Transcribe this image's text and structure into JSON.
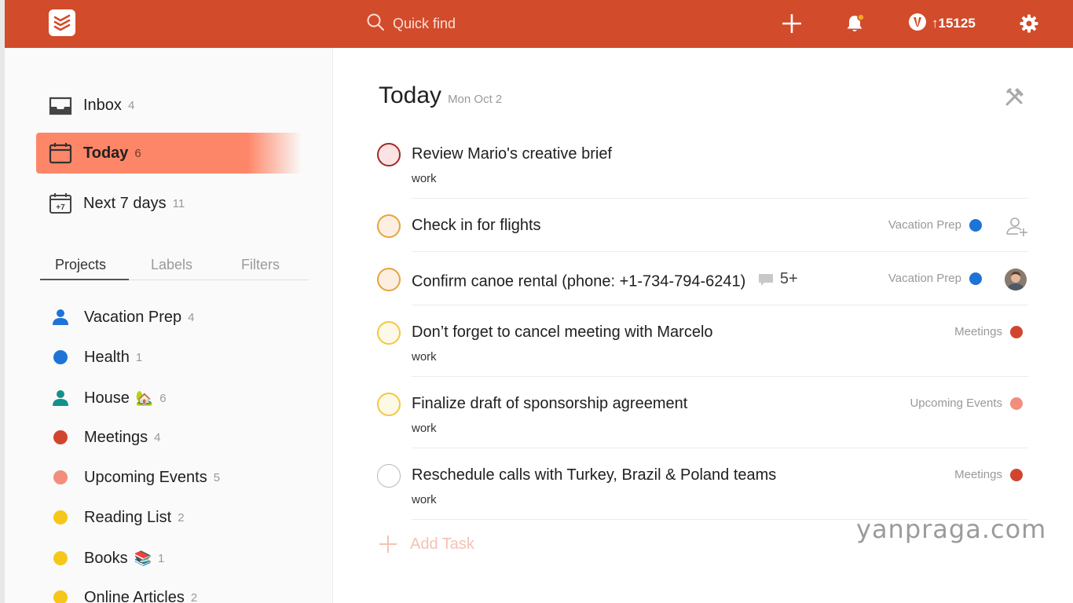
{
  "topbar": {
    "search_placeholder": "Quick find",
    "karma": "↑15125",
    "icons": [
      "todoist-logo-icon",
      "search-icon",
      "plus-icon",
      "bell-icon",
      "karma-icon",
      "gear-icon"
    ],
    "color": "#d24b2b"
  },
  "sidebar": {
    "nav": [
      {
        "label": "Inbox",
        "count": "4",
        "icon": "inbox-icon"
      },
      {
        "label": "Today",
        "count": "6",
        "icon": "calendar-icon"
      },
      {
        "label": "Next 7 days",
        "count": "11",
        "icon": "calendar-plus7-icon"
      }
    ],
    "plus7": "+7",
    "tabs": [
      "Projects",
      "Labels",
      "Filters"
    ],
    "projects": [
      {
        "label": "Vacation Prep",
        "count": "4",
        "color": "#246fe0",
        "icon": "person-icon"
      },
      {
        "label": "Health",
        "count": "1",
        "color": "#1e73d6",
        "icon": "dot"
      },
      {
        "label": "House",
        "count": "6",
        "color": "#14aaa0",
        "icon": "person-icon",
        "emoji": "🏡"
      },
      {
        "label": "Meetings",
        "count": "4",
        "color": "#d1452f",
        "icon": "dot"
      },
      {
        "label": "Upcoming Events",
        "count": "5",
        "color": "#f28f7c",
        "icon": "dot"
      },
      {
        "label": "Reading List",
        "count": "2",
        "color": "#f5c71a",
        "icon": "dot"
      },
      {
        "label": "Books",
        "count": "1",
        "color": "#f5c71a",
        "icon": "dot",
        "emoji": "📚"
      },
      {
        "label": "Online Articles",
        "count": "2",
        "color": "#f5c71a",
        "icon": "dot"
      }
    ]
  },
  "main": {
    "title": "Today",
    "date": "Mon Oct 2",
    "tasks": [
      {
        "content": "Review Mario's creative brief",
        "label": "work",
        "project": "",
        "priority_color": "#c0392b",
        "fill": "#fbe3e3"
      },
      {
        "content": "Check in for flights",
        "label": "",
        "project": "Vacation Prep",
        "project_color": "#1e73d6",
        "priority_color": "#e8a33d",
        "fill": "#fcefe1",
        "action": "assign-icon"
      },
      {
        "content": "Confirm canoe rental (phone: +1-734-794-6241)",
        "comment_count": "5+",
        "label": "",
        "project": "Vacation Prep",
        "project_color": "#1e73d6",
        "priority_color": "#e8a33d",
        "fill": "#fcefe1",
        "action": "avatar"
      },
      {
        "content": "Don’t forget to cancel meeting with Marcelo",
        "label": "work",
        "project": "Meetings",
        "project_color": "#d1452f",
        "priority_color": "#f2c744",
        "fill": "#fef9e6"
      },
      {
        "content": "Finalize draft of sponsorship agreement",
        "label": "work",
        "project": "Upcoming Events",
        "project_color": "#f28f7c",
        "priority_color": "#f2c744",
        "fill": "#fef9e6"
      },
      {
        "content": "Reschedule calls with Turkey, Brazil & Poland teams",
        "label": "work",
        "project": "Meetings",
        "project_color": "#d1452f",
        "priority_color": "#b8b8b8",
        "fill": "#ffffff"
      }
    ],
    "add_task": "Add Task"
  },
  "watermark": "yanpraga.com"
}
